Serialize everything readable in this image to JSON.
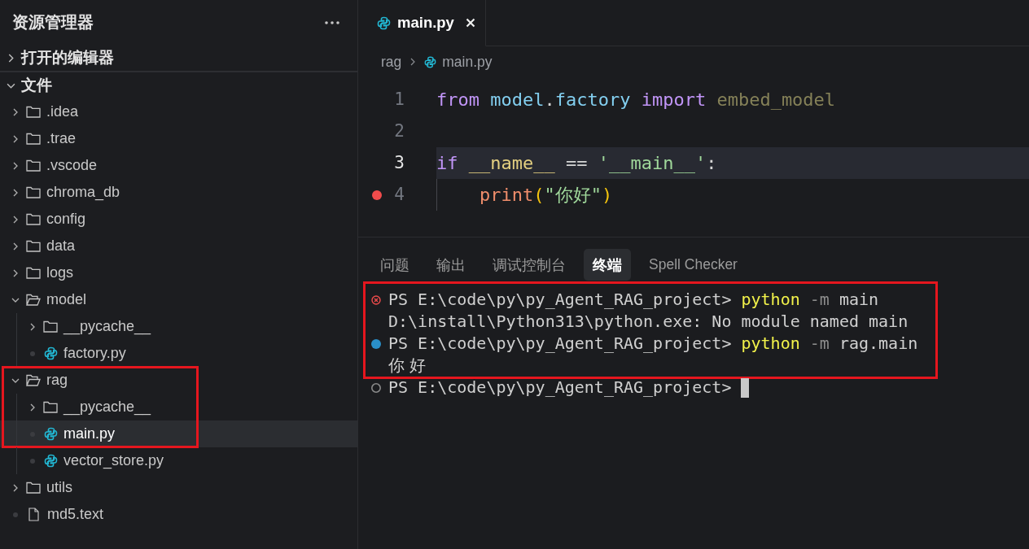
{
  "sidebar": {
    "title": "资源管理器",
    "sections": [
      {
        "label": "打开的编辑器",
        "expanded": false
      },
      {
        "label": "文件",
        "expanded": true,
        "tree": [
          {
            "name": ".idea",
            "kind": "folder",
            "expanded": false,
            "selected": false,
            "boxed": false
          },
          {
            "name": ".trae",
            "kind": "folder",
            "expanded": false,
            "selected": false,
            "boxed": false
          },
          {
            "name": ".vscode",
            "kind": "folder",
            "expanded": false,
            "selected": false,
            "boxed": false
          },
          {
            "name": "chroma_db",
            "kind": "folder",
            "expanded": false,
            "selected": false,
            "boxed": false
          },
          {
            "name": "config",
            "kind": "folder",
            "expanded": false,
            "selected": false,
            "boxed": false
          },
          {
            "name": "data",
            "kind": "folder",
            "expanded": false,
            "selected": false,
            "boxed": false
          },
          {
            "name": "logs",
            "kind": "folder",
            "expanded": false,
            "selected": false,
            "boxed": false
          },
          {
            "name": "model",
            "kind": "folder",
            "expanded": true,
            "selected": false,
            "boxed": false,
            "children": [
              {
                "name": "__pycache__",
                "kind": "folder",
                "expanded": false,
                "selected": false,
                "boxed": false
              },
              {
                "name": "factory.py",
                "kind": "python",
                "selected": false,
                "boxed": false
              }
            ]
          },
          {
            "name": "rag",
            "kind": "folder",
            "expanded": true,
            "selected": false,
            "boxed": true,
            "children": [
              {
                "name": "__pycache__",
                "kind": "folder",
                "expanded": false,
                "selected": false,
                "boxed": true
              },
              {
                "name": "main.py",
                "kind": "python",
                "selected": true,
                "boxed": true
              },
              {
                "name": "vector_store.py",
                "kind": "python",
                "selected": false,
                "boxed": false
              }
            ]
          },
          {
            "name": "utils",
            "kind": "folder",
            "expanded": false,
            "selected": false,
            "boxed": false
          },
          {
            "name": "md5.text",
            "kind": "file",
            "selected": false,
            "boxed": false
          }
        ]
      }
    ]
  },
  "editor": {
    "tabs": [
      {
        "label": "main.py",
        "kind": "python",
        "selected": true
      }
    ],
    "breadcrumb": [
      {
        "label": "rag",
        "kind": "folder"
      },
      {
        "label": "main.py",
        "kind": "python"
      }
    ],
    "lines": [
      {
        "number": "1",
        "current": false,
        "breakpoint": false,
        "indented": false,
        "tokens": [
          {
            "kind": "keyword",
            "text": "from "
          },
          {
            "kind": "module",
            "text": "model"
          },
          {
            "kind": "punct",
            "text": "."
          },
          {
            "kind": "module",
            "text": "factory "
          },
          {
            "kind": "keyword",
            "text": "import "
          },
          {
            "kind": "unused",
            "text": "embed_model"
          }
        ]
      },
      {
        "number": "2",
        "current": false,
        "breakpoint": false,
        "indented": false
      },
      {
        "number": "3",
        "current": true,
        "breakpoint": false,
        "indented": false,
        "tokens": [
          {
            "kind": "keyword",
            "text": "if "
          },
          {
            "kind": "variable",
            "text": "__name__ "
          },
          {
            "kind": "punct",
            "text": "== "
          },
          {
            "kind": "string",
            "text": "'__main__'"
          },
          {
            "kind": "punct",
            "text": ":"
          }
        ]
      },
      {
        "number": "4",
        "current": false,
        "breakpoint": true,
        "indented": true,
        "tokens": [
          {
            "kind": "function",
            "text": "print"
          },
          {
            "kind": "bracket",
            "text": "("
          },
          {
            "kind": "string",
            "text": "\"你好\""
          },
          {
            "kind": "bracket",
            "text": ")"
          }
        ]
      }
    ]
  },
  "panel": {
    "tabs": [
      {
        "label": "问题",
        "selected": false
      },
      {
        "label": "输出",
        "selected": false
      },
      {
        "label": "调试控制台",
        "selected": false
      },
      {
        "label": "终端",
        "selected": true
      },
      {
        "label": "Spell Checker",
        "selected": false
      }
    ],
    "terminal": [
      {
        "kind": "failed",
        "boxed": true,
        "cursor": false,
        "tokens": [
          {
            "kind": "plain",
            "text": "PS E:\\code\\py\\py_Agent_RAG_project> "
          },
          {
            "kind": "command",
            "text": "python"
          },
          {
            "kind": "flag",
            "text": " -m"
          },
          {
            "kind": "plain",
            "text": " main"
          }
        ]
      },
      {
        "kind": "output",
        "boxed": true,
        "cursor": false,
        "tokens": [
          {
            "kind": "plain",
            "text": "D:\\install\\Python313\\python.exe: No module named main"
          }
        ]
      },
      {
        "kind": "succeeded",
        "boxed": true,
        "cursor": false,
        "tokens": [
          {
            "kind": "plain",
            "text": "PS E:\\code\\py\\py_Agent_RAG_project> "
          },
          {
            "kind": "command",
            "text": "python"
          },
          {
            "kind": "flag",
            "text": " -m"
          },
          {
            "kind": "plain",
            "text": " rag.main"
          }
        ]
      },
      {
        "kind": "output",
        "boxed": true,
        "cursor": false,
        "tokens": [
          {
            "kind": "wide",
            "text": "你好"
          }
        ]
      },
      {
        "kind": "prompt",
        "boxed": false,
        "cursor": true,
        "tokens": [
          {
            "kind": "plain",
            "text": "PS E:\\code\\py\\py_Agent_RAG_project> "
          }
        ]
      }
    ]
  }
}
